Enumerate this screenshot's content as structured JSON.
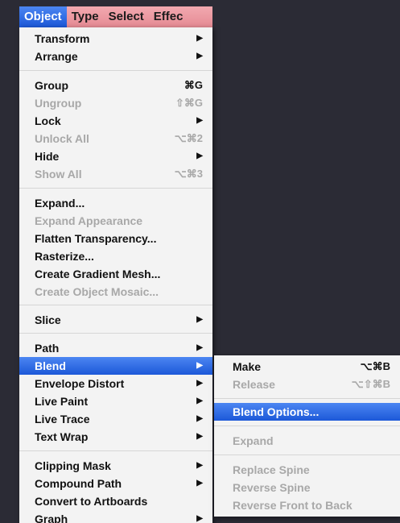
{
  "menubar": {
    "items": [
      "Object",
      "Type",
      "Select",
      "Effec"
    ]
  },
  "main_menu": {
    "items": [
      {
        "label": "Transform",
        "submenu": true
      },
      {
        "label": "Arrange",
        "submenu": true
      },
      {
        "label": "Group",
        "shortcut": "⌘G"
      },
      {
        "label": "Ungroup",
        "shortcut": "⇧⌘G",
        "disabled": true
      },
      {
        "label": "Lock",
        "submenu": true
      },
      {
        "label": "Unlock All",
        "shortcut": "⌥⌘2",
        "disabled": true
      },
      {
        "label": "Hide",
        "submenu": true
      },
      {
        "label": "Show All",
        "shortcut": "⌥⌘3",
        "disabled": true
      },
      {
        "label": "Expand..."
      },
      {
        "label": "Expand Appearance",
        "disabled": true
      },
      {
        "label": "Flatten Transparency..."
      },
      {
        "label": "Rasterize..."
      },
      {
        "label": "Create Gradient Mesh..."
      },
      {
        "label": "Create Object Mosaic...",
        "disabled": true
      },
      {
        "label": "Slice",
        "submenu": true
      },
      {
        "label": "Path",
        "submenu": true
      },
      {
        "label": "Blend",
        "submenu": true,
        "selected": true
      },
      {
        "label": "Envelope Distort",
        "submenu": true
      },
      {
        "label": "Live Paint",
        "submenu": true
      },
      {
        "label": "Live Trace",
        "submenu": true
      },
      {
        "label": "Text Wrap",
        "submenu": true
      },
      {
        "label": "Clipping Mask",
        "submenu": true
      },
      {
        "label": "Compound Path",
        "submenu": true
      },
      {
        "label": "Convert to Artboards"
      },
      {
        "label": "Graph",
        "submenu": true
      }
    ]
  },
  "blend_submenu": {
    "items": [
      {
        "label": "Make",
        "shortcut": "⌥⌘B"
      },
      {
        "label": "Release",
        "shortcut": "⌥⇧⌘B",
        "disabled": true
      },
      {
        "label": "Blend Options...",
        "selected": true
      },
      {
        "label": "Expand",
        "disabled": true
      },
      {
        "label": "Replace Spine",
        "disabled": true
      },
      {
        "label": "Reverse Spine",
        "disabled": true
      },
      {
        "label": "Reverse Front to Back",
        "disabled": true
      }
    ]
  },
  "icons": {
    "submenu_arrow": "right-triangle-icon",
    "submenu_arrow_glyph": "▶"
  },
  "colors": {
    "menubar_bg": "#e58a93",
    "selection": "#2a66e0",
    "disabled_text": "#a8a8a8",
    "background": "#2b2b35"
  }
}
